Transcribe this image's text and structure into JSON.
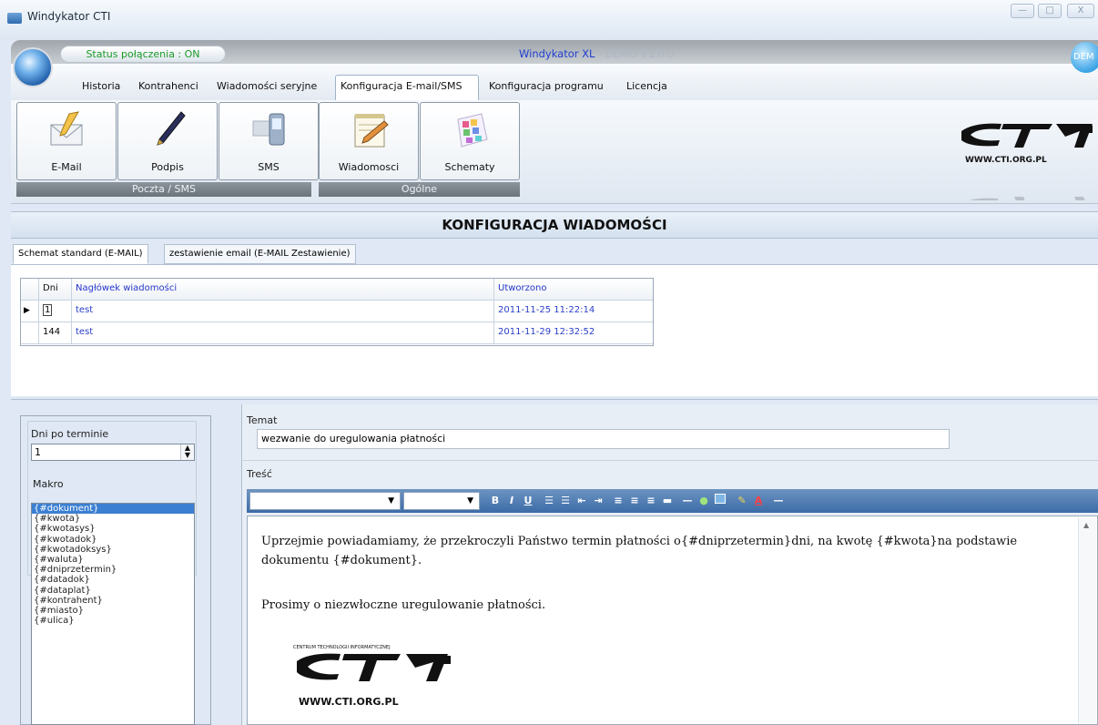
{
  "window": {
    "title": "Windykator CTI",
    "minimize": "—",
    "maximize": "□",
    "close": "X"
  },
  "header": {
    "status": "Status połączenia : ON",
    "brand": "Windykator XL",
    "brand_dash": " - ",
    "version": "DEMO V1.0.0",
    "badge": "DEM"
  },
  "menu": {
    "items": [
      "Historia",
      "Kontrahenci",
      "Wiadomości seryjne",
      "Konfiguracja E-mail/SMS",
      "Konfiguracja programu",
      "Licencja"
    ],
    "active_index": 3
  },
  "toolbar": {
    "buttons": [
      {
        "label": "E-Mail",
        "icon": "email-icon"
      },
      {
        "label": "Podpis",
        "icon": "pen-icon"
      },
      {
        "label": "SMS",
        "icon": "phone-icon"
      },
      {
        "label": "Wiadomosci",
        "icon": "notepad-icon"
      },
      {
        "label": "Schematy",
        "icon": "palette-icon"
      }
    ],
    "groups": [
      "Poczta / SMS",
      "Ogólne"
    ]
  },
  "logo": {
    "text": "WWW.CTI.ORG.PL"
  },
  "section": {
    "title": "KONFIGURACJA WIADOMOŚCI"
  },
  "tabs": [
    "Schemat standard (E-MAIL)",
    "zestawienie email (E-MAIL Zestawienie)"
  ],
  "grid": {
    "columns": [
      "Dni",
      "Nagłówek wiadomości",
      "Utworzono"
    ],
    "rows": [
      {
        "dni": "1",
        "header": "test",
        "created": "2011-11-25 11:22:14"
      },
      {
        "dni": "144",
        "header": "test",
        "created": "2011-11-29 12:32:52"
      }
    ],
    "selected_row": 0
  },
  "left_panel": {
    "dni_label": "Dni po terminie",
    "dni_value": "1",
    "makro_label": "Makro",
    "macros": [
      "{#dokument}",
      "{#kwota}",
      "{#kwotasys}",
      "{#kwotadok}",
      "{#kwotadoksys}",
      "{#waluta}",
      "{#dniprzetermin}",
      "{#datadok}",
      "{#dataplat}",
      "{#kontrahent}",
      "{#miasto}",
      "{#ulica}"
    ],
    "selected_macro": 0
  },
  "editor": {
    "temat_label": "Temat",
    "temat_value": "wezwanie do uregulowania płatności",
    "tresc_label": "Treść",
    "body_line1": "Uprzejmie powiadamiamy, że przekroczyli Państwo termin płatności o{#dniprzetermin}dni, na kwotę {#kwota}na podstawie dokumentu {#dokument}.",
    "body_line2": "Prosimy o niezwłoczne uregulowanie płatności.",
    "signature_caption": "CENTRUM TECHNOLOGII INFORMATYCZNEJ",
    "signature_url": "WWW.CTI.ORG.PL"
  },
  "colors": {
    "accent": "#2535c9",
    "status_green": "#1a9a2a",
    "toolbar_blue": "#3c6ba8"
  }
}
